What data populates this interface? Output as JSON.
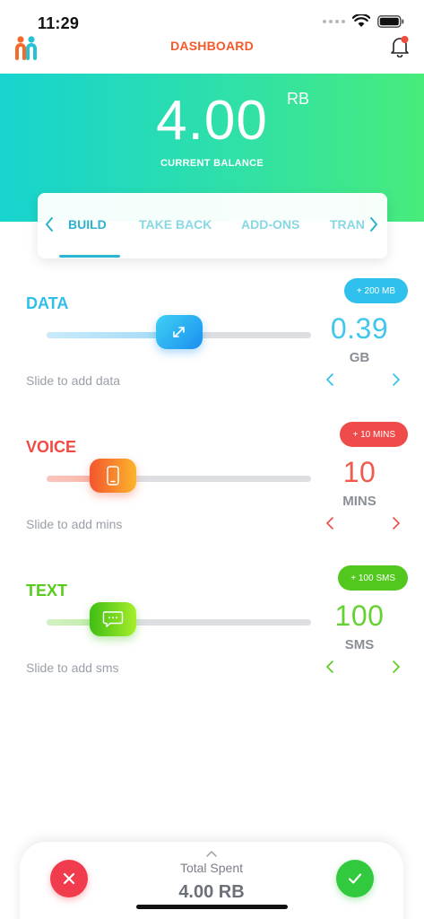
{
  "status_bar": {
    "time": "11:29"
  },
  "header": {
    "title": "DASHBOARD"
  },
  "balance": {
    "value": "4.00",
    "unit": "RB",
    "label": "CURRENT BALANCE"
  },
  "tabs": [
    {
      "label": "BUILD",
      "active": true
    },
    {
      "label": "TAKE BACK",
      "active": false
    },
    {
      "label": "ADD-ONS",
      "active": false
    },
    {
      "label": "TRAN",
      "active": false
    }
  ],
  "sliders": {
    "data": {
      "title": "DATA",
      "hint": "Slide to add data",
      "badge": "+ 200  MB",
      "amount": "0.39",
      "unit": "GB",
      "level": 0.5,
      "color": "#2fbfe8",
      "icon": "data-transfer-icon"
    },
    "voice": {
      "title": "VOICE",
      "hint": "Slide to add mins",
      "badge": "+ 10  MINS",
      "amount": "10",
      "unit": "MINS",
      "level": 0.25,
      "color": "#f14a45",
      "icon": "phone-icon"
    },
    "text": {
      "title": "TEXT",
      "hint": "Slide to add sms",
      "badge": "+ 100  SMS",
      "amount": "100",
      "unit": "SMS",
      "level": 0.25,
      "color": "#58cc1d",
      "icon": "message-icon"
    }
  },
  "footer": {
    "total_label": "Total Spent",
    "total_value": "4.00 RB"
  },
  "colors": {
    "accent": "#f35a2c",
    "hero_start": "#17d4cf",
    "hero_end": "#48ec7b",
    "cancel": "#f13c4e",
    "confirm": "#31c93e"
  }
}
